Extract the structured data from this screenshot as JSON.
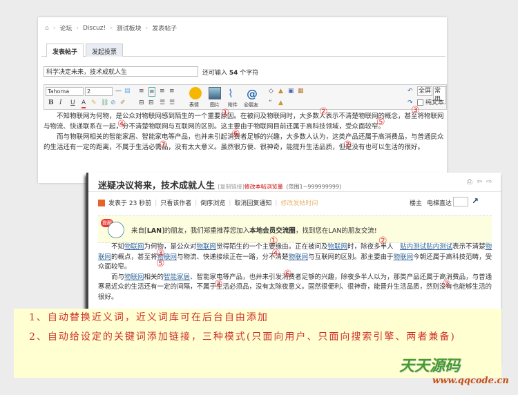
{
  "editor_window": {
    "breadcrumb": [
      "论坛",
      "Discuz!",
      "测试板块",
      "发表帖子"
    ],
    "tabs": [
      {
        "label": "发表帖子",
        "active": true
      },
      {
        "label": "发起投票",
        "active": false
      }
    ],
    "title_value": "科学决定未来，技术成就人生",
    "remaining_prefix": "还可输入",
    "remaining_count": "54",
    "remaining_suffix": "个字符",
    "toolbar": {
      "font": "Tahoma",
      "size": "2",
      "bold": "B",
      "italic": "I",
      "underline": "U",
      "text_color": "A",
      "emoji": "表情",
      "image": "图片",
      "attachment": "附件",
      "mention": "@朋友",
      "quote": "“",
      "fullscreen": "全屏",
      "common": "常用",
      "plain_text": "纯文本"
    },
    "paragraphs": [
      "不知物联网为何物，是公众对物联网感到陌生的一个重要原因。在被问及物联网时，大多数人表示不清楚物联网的概念，甚至将物联网与物流、快递联系在一起，分不清楚物联网与互联网的区别。这主要由于物联网目前还属于高科技领域，受众面较窄。",
      "而与物联网相关的智能家居、智能家电等产品，也并未引起消费者足够的兴趣，大多数人认为，这类产品还属于高消费品，与普通民众的生活还有一定的距离，不属于生活必需品，没有太大意义。虽然很方便、很神奇，能提升生活品质，但是没有也可以生活的很好。"
    ],
    "annotations": [
      "①",
      "②",
      "③",
      "④",
      "⑤",
      "⑥",
      "⑦",
      "⑦"
    ]
  },
  "view_window": {
    "title": "迷疑决议将来，技术成就人生",
    "copy_link": "[复制链接]",
    "modify_views": "修改本帖浏览量",
    "range": "(范围1~999999999)",
    "meta": {
      "posted": "发表于 23 秒前",
      "only_author": "只看该作者",
      "reverse": "倒序浏览",
      "cancel_notify": "取消回复通知",
      "modify_time": "修改发帖时间",
      "floor_owner": "楼主",
      "elevator": "电梯直达"
    },
    "notice": {
      "badge": "提醒",
      "prefix": "来自[",
      "lan": "LAN",
      "mid": "]的朋友，我们郑重推荐您加入",
      "circle": "本地会员交流圈",
      "suffix": "，找到您在LAN的朋友交流!"
    },
    "paragraphs": [
      [
        {
          "t": "不知"
        },
        {
          "t": "物联网",
          "k": 1
        },
        {
          "t": "为何物，是公众对"
        },
        {
          "t": "物联网",
          "k": 1
        },
        {
          "t": "觉得陌生的一个主要缘由。正在被问及"
        },
        {
          "t": "物联网",
          "k": 1
        },
        {
          "t": "时，除夜多半人　"
        },
        {
          "t": "贴内测试贴内测试",
          "k": 1
        },
        {
          "t": "表示不清楚"
        },
        {
          "t": "物联网",
          "k": 1
        },
        {
          "t": "的概点，甚至将"
        },
        {
          "t": "物联网",
          "k": 1
        },
        {
          "t": "与物流、快递接续正在一路，分不清楚"
        },
        {
          "t": "物联网",
          "k": 1
        },
        {
          "t": "与互联网的区别。那主要由于"
        },
        {
          "t": "物联网",
          "k": 1
        },
        {
          "t": "今朝还属于高科技范畴，受众面较窄。"
        }
      ],
      [
        {
          "t": "而与"
        },
        {
          "t": "物联网",
          "k": 1
        },
        {
          "t": "相关的"
        },
        {
          "t": "智能家居",
          "k": 1
        },
        {
          "t": "、智能家电等产品，也并未引发消费者足够的兴趣，除夜多半人以为，那类产品还属于高消费品，与普通寒易近众的生活还有一定的间隔，不属于生活必须品，没有太除夜意义。固然很便利、很神奇，能晋升生活品质，然则没有也能够生活的很好。"
        }
      ]
    ],
    "annotations": [
      "①",
      "②",
      "③",
      "④",
      "⑤",
      "⑥",
      "⑦",
      "⑦"
    ]
  },
  "notes": [
    "1、自动替换近义词，近义词库可在后台自由添加",
    "2、自动给设定的关键词添加链接，三种模式(只面向用户、只面向搜索引擎、两者兼备)"
  ],
  "watermark": {
    "name": "天天源码",
    "url": "www.qqcode.cn"
  }
}
